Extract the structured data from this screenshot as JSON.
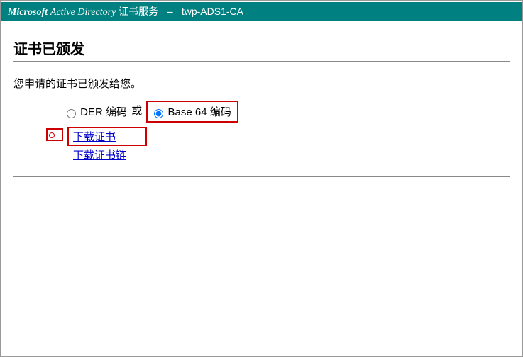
{
  "header": {
    "brand": "Microsoft",
    "brand_product": "Active Directory",
    "service_label": "证书服务",
    "separator": "--",
    "ca_name": "twp-ADS1-CA"
  },
  "title": "证书已颁发",
  "message": "您申请的证书已颁发给您。",
  "encoding": {
    "der_label": "DER 编码",
    "or_text": "或",
    "base64_label": "Base 64 编码",
    "selected": "base64"
  },
  "downloads": {
    "cert_link": "下载证书",
    "chain_link": "下载证书链"
  }
}
